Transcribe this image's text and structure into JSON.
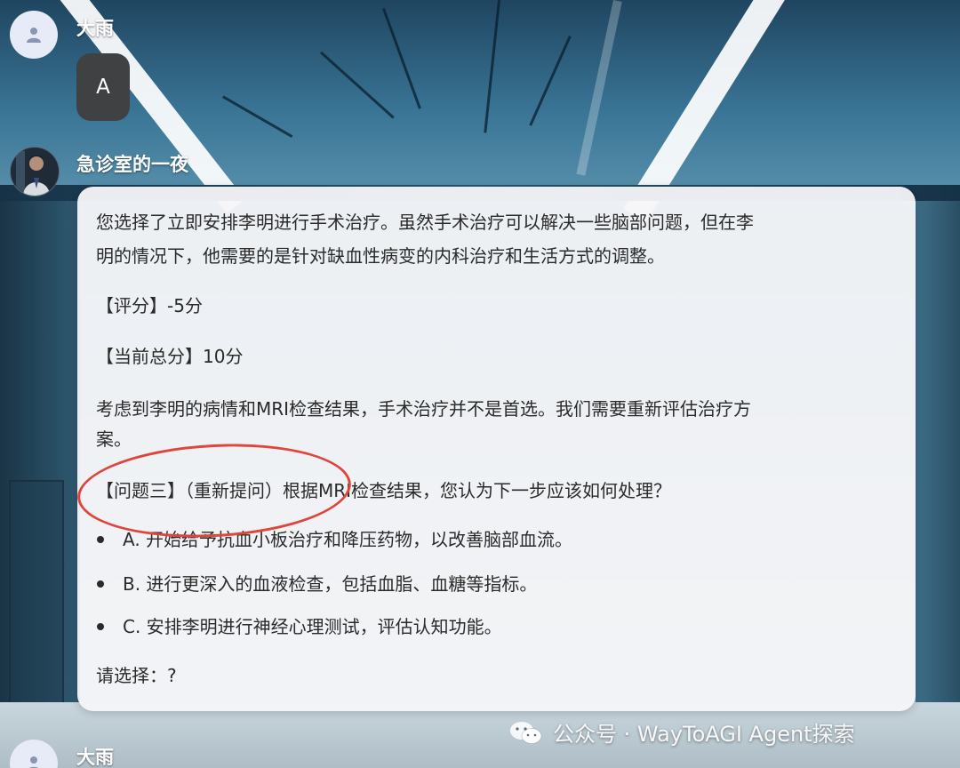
{
  "messages": [
    {
      "role": "user",
      "author": "大雨",
      "text": "A"
    },
    {
      "role": "bot",
      "author": "急诊室的一夜",
      "paragraphs": [
        "您选择了立即安排李明进行手术治疗。虽然手术治疗可以解决一些脑部问题，但在李",
        "明的情况下，他需要的是针对缺血性病变的内科治疗和生活方式的调整。",
        "【评分】-5分",
        "【当前总分】10分",
        "考虑到李明的病情和MRI检查结果，手术治疗并不是首选。我们需要重新评估治疗方",
        "案。",
        "【问题三】（重新提问）根据MRI检查结果，您认为下一步应该如何处理？"
      ],
      "options": [
        "A. 开始给予抗血小板治疗和降压药物，以改善脑部血流。",
        "B. 进行更深入的血液检查，包括血脂、血糖等指标。",
        "C. 安排李明进行神经心理测试，评估认知功能。"
      ],
      "prompt": "请选择：?"
    },
    {
      "role": "user",
      "author": "大雨"
    }
  ],
  "watermark": "公众号 · WayToAGI Agent探索",
  "icons": {
    "user_avatar": "person-icon",
    "bot_avatar": "character-portrait",
    "watermark": "wechat-icon"
  },
  "colors": {
    "annotation_circle": "#e0453b",
    "user_bubble": "#3f4143",
    "card": "#f6f6f8"
  }
}
